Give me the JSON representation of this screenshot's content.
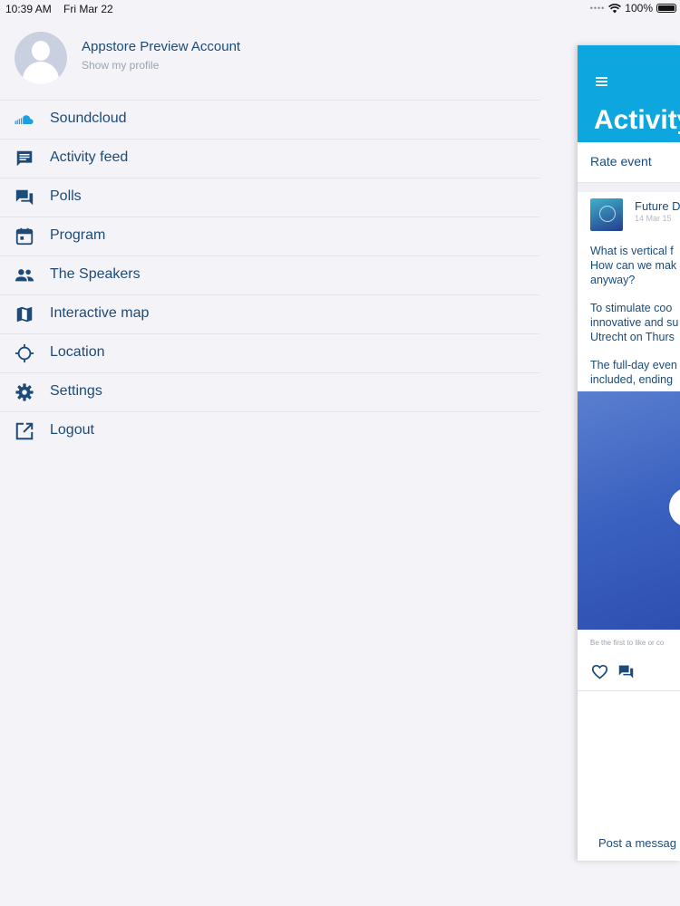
{
  "status_bar": {
    "time": "10:39 AM",
    "date": "Fri Mar 22",
    "battery": "100%"
  },
  "profile": {
    "name": "Appstore Preview Account",
    "subtitle": "Show my profile"
  },
  "menu": {
    "items": [
      {
        "label": "Soundcloud",
        "icon": "soundcloud-icon"
      },
      {
        "label": "Activity feed",
        "icon": "message-icon"
      },
      {
        "label": "Polls",
        "icon": "forum-icon"
      },
      {
        "label": "Program",
        "icon": "calendar-icon"
      },
      {
        "label": "The Speakers",
        "icon": "people-icon"
      },
      {
        "label": "Interactive map",
        "icon": "map-icon"
      },
      {
        "label": "Location",
        "icon": "crosshair-icon"
      },
      {
        "label": "Settings",
        "icon": "gear-icon"
      },
      {
        "label": "Logout",
        "icon": "external-link-icon"
      }
    ]
  },
  "panel": {
    "title": "Activity",
    "rate_event": "Rate event",
    "post": {
      "author": "Future D",
      "date": "14 Mar 15",
      "text": [
        [
          "What is vertical f",
          "How can we mak",
          "anyway?"
        ],
        [
          "To stimulate coo",
          "innovative and su",
          "Utrecht on Thurs"
        ],
        [
          "The full-day even",
          "included, ending"
        ]
      ],
      "likes_text": "Be the first to like or co"
    },
    "post_message": "Post a messag"
  },
  "colors": {
    "accent": "#0ea6de",
    "text": "#1c4b79",
    "muted": "#9aa4b3",
    "background": "#f4f3f8"
  }
}
